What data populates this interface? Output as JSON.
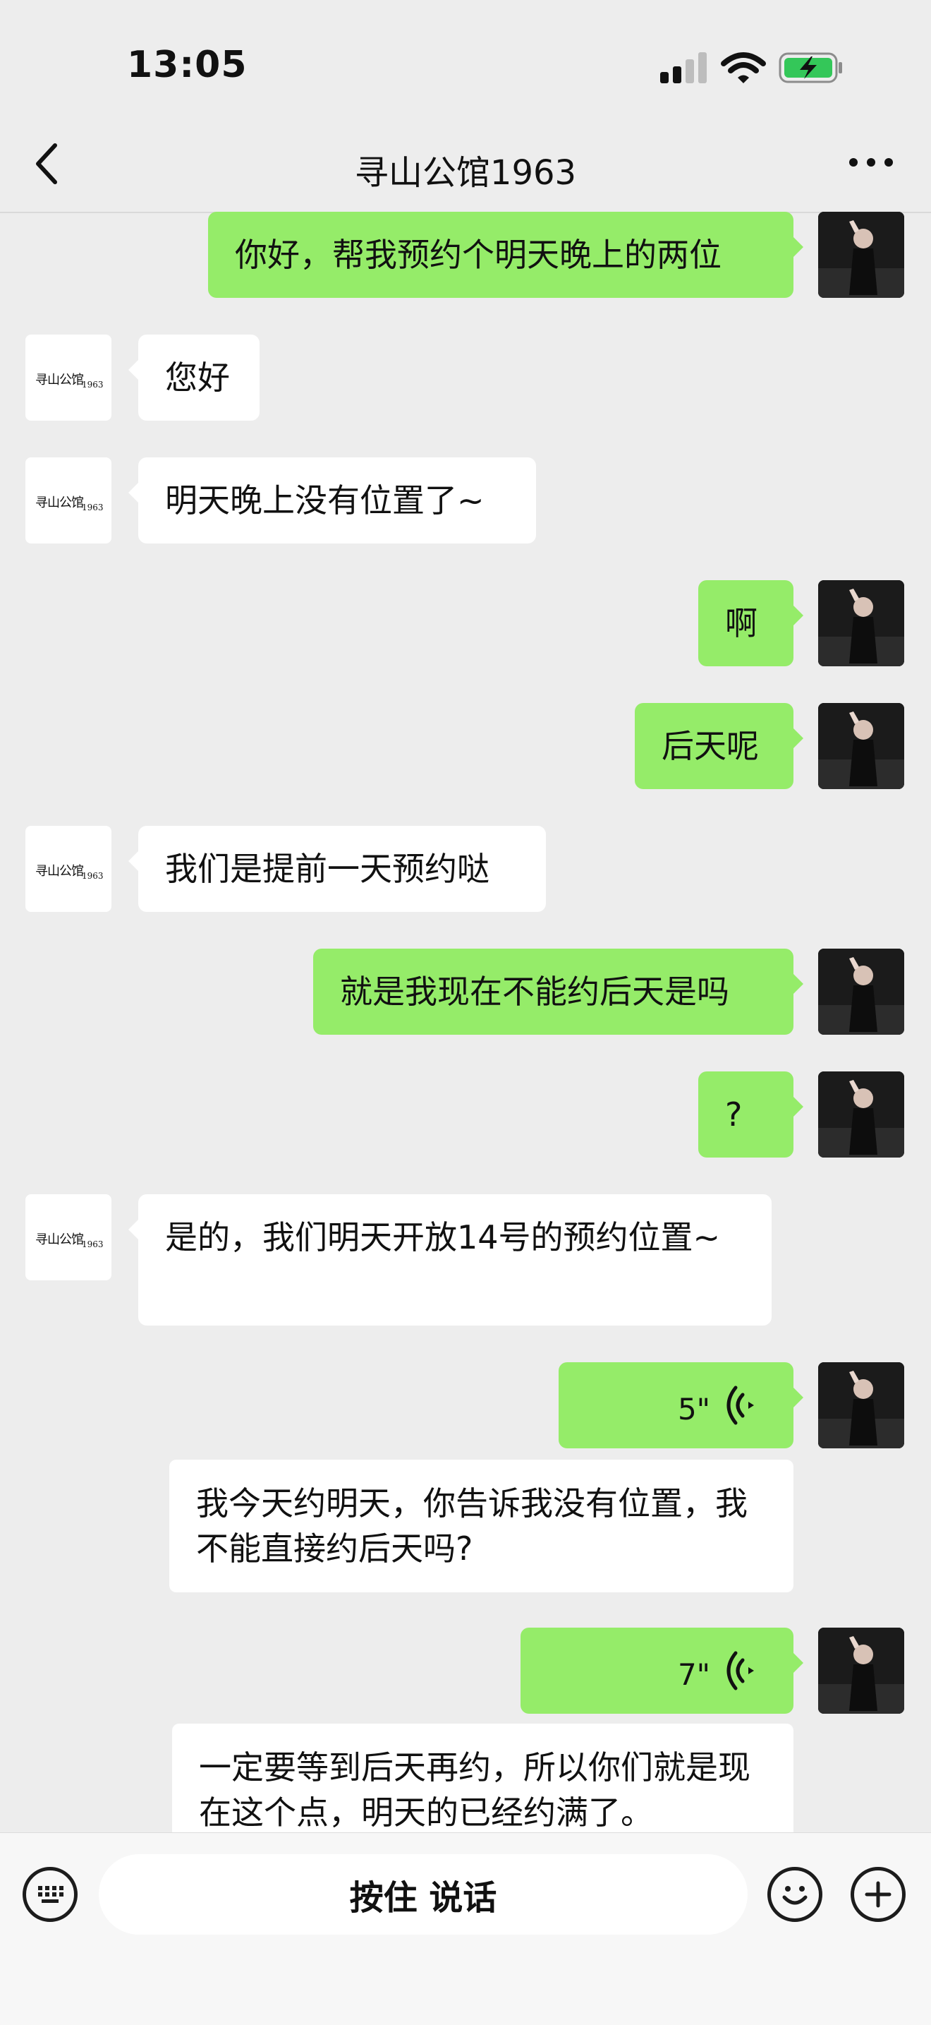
{
  "status_bar": {
    "time": "13:05"
  },
  "nav": {
    "title": "寻山公馆1963"
  },
  "shop_logo": {
    "name": "寻山公馆",
    "year": "1963"
  },
  "messages": [
    {
      "from": "me",
      "text": "你好，帮我预约个明天晚上的两位"
    },
    {
      "from": "shop",
      "text": "您好"
    },
    {
      "from": "shop",
      "text": "明天晚上没有位置了~"
    },
    {
      "from": "me",
      "text": "啊"
    },
    {
      "from": "me",
      "text": "后天呢"
    },
    {
      "from": "shop",
      "text": "我们是提前一天预约哒"
    },
    {
      "from": "me",
      "text": "就是我现在不能约后天是吗"
    },
    {
      "from": "me",
      "text": "?"
    },
    {
      "from": "shop",
      "text": "是的，我们明天开放14号的预约位置~"
    },
    {
      "from": "me",
      "type": "voice",
      "duration": "5\"",
      "transcript": "我今天约明天，你告诉我没有位置，我不能直接约后天吗?"
    },
    {
      "from": "me",
      "type": "voice",
      "duration": "7\"",
      "transcript": "一定要等到后天再约，所以你们就是现在这个点，明天的已经约满了。"
    }
  ],
  "input_bar": {
    "hold_to_talk": "按住 说话"
  },
  "colors": {
    "sent_bubble": "#95ec69",
    "received_bubble": "#ffffff",
    "background": "#ededed"
  }
}
